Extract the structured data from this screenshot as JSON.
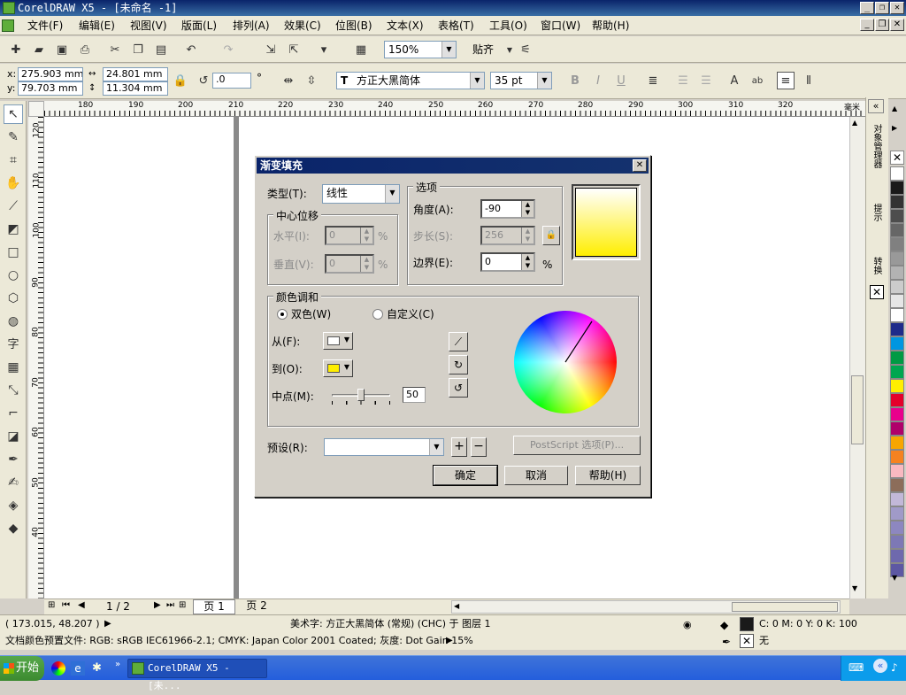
{
  "window": {
    "title": "CorelDRAW X5 - [未命名 -1]"
  },
  "menu": [
    "文件(F)",
    "编辑(E)",
    "视图(V)",
    "版面(L)",
    "排列(A)",
    "效果(C)",
    "位图(B)",
    "文本(X)",
    "表格(T)",
    "工具(O)",
    "窗口(W)",
    "帮助(H)"
  ],
  "standard_toolbar": {
    "zoom": "150%",
    "snap_label": "贴齐"
  },
  "property_bar": {
    "x": "275.903 mm",
    "y": "79.703 mm",
    "width": "24.801 mm",
    "height": "11.304 mm",
    "rotation": ".0",
    "degree_unit": "°",
    "font": "方正大黑简体",
    "font_size": "35 pt"
  },
  "ruler": {
    "h_labels": [
      "180",
      "190",
      "200",
      "210",
      "220",
      "230",
      "240",
      "250",
      "260",
      "270",
      "280",
      "290",
      "300",
      "310",
      "320"
    ],
    "h_unit": "毫米",
    "v_labels": [
      "120",
      "110",
      "100",
      "90",
      "80",
      "70",
      "60",
      "50",
      "40"
    ]
  },
  "dialog": {
    "title": "渐变填充",
    "type_label": "类型(T):",
    "type_value": "线性",
    "center_group": "中心位移",
    "horizontal_label": "水平(I):",
    "horizontal_value": "0",
    "vertical_label": "垂直(V):",
    "vertical_value": "0",
    "percent": "%",
    "options_group": "选项",
    "angle_label": "角度(A):",
    "angle_value": "-90",
    "steps_label": "步长(S):",
    "steps_value": "256",
    "edge_label": "边界(E):",
    "edge_value": "0",
    "blend_group": "颜色调和",
    "two_color_label": "双色(W)",
    "custom_label": "自定义(C)",
    "from_label": "从(F):",
    "from_color": "#ffffff",
    "to_label": "到(O):",
    "to_color": "#ffee00",
    "mid_label": "中点(M):",
    "mid_value": "50",
    "mid_fraction": 0.5,
    "presets_label": "预设(R):",
    "postscript_label": "PostScript 选项(P)...",
    "ok_label": "确定",
    "cancel_label": "取消",
    "help_label": "帮助(H)"
  },
  "pages": {
    "count": "1 / 2",
    "tab1": "页 1",
    "tab2": "页 2"
  },
  "status": {
    "coords": "( 173.015, 48.207 )",
    "object_info": "美术字: 方正大黑简体 (常规) (CHC) 于 图层 1",
    "fill_info": "C: 0 M: 0 Y: 0 K: 100",
    "color_profile": "文档颜色预置文件: RGB: sRGB IEC61966-2.1; CMYK: Japan Color 2001 Coated; 灰度: Dot Gain 15%",
    "outline_info": "无"
  },
  "docker": {
    "tab1": "对象管理器",
    "tab2": "提示",
    "tab3": "转换"
  },
  "palette": [
    "#ffffff",
    "#1a1a1a",
    "#333333",
    "#4d4d4d",
    "#666666",
    "#808080",
    "#999999",
    "#b3b3b3",
    "#cccccc",
    "#e6e6e6",
    "#ffffff",
    "#1e2b8a",
    "#0096e0",
    "#009a44",
    "#00a650",
    "#ffee00",
    "#e4002b",
    "#e9008c",
    "#b0006a",
    "#f7a600",
    "#f58220",
    "#f9b9c1",
    "#8c6d5a",
    "#c2b8d8",
    "#a09ac8",
    "#8d87c0",
    "#7d78b5",
    "#6e69ad",
    "#5d58a3"
  ],
  "taskbar": {
    "start": "开始",
    "task": "CorelDRAW X5 - [未..."
  }
}
